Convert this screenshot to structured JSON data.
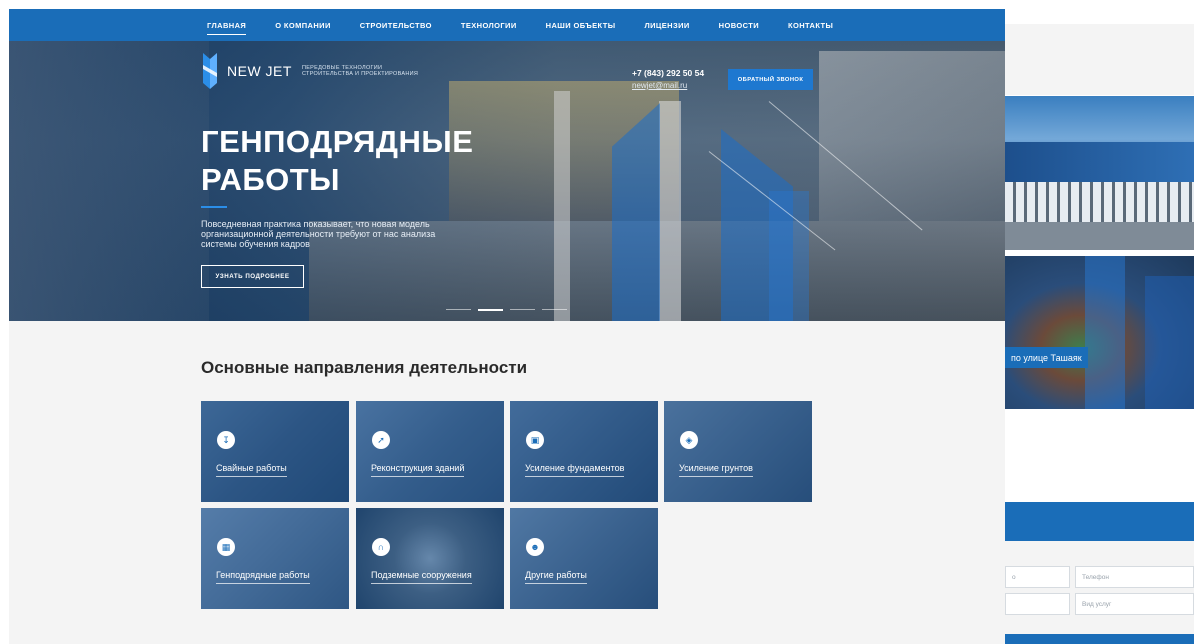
{
  "nav": {
    "items": [
      {
        "label": "ГЛАВНАЯ",
        "active": true
      },
      {
        "label": "О КОМПАНИИ",
        "active": false
      },
      {
        "label": "СТРОИТЕЛЬСТВО",
        "active": false
      },
      {
        "label": "ТЕХНОЛОГИИ",
        "active": false
      },
      {
        "label": "НАШИ ОБЪЕКТЫ",
        "active": false
      },
      {
        "label": "ЛИЦЕНЗИИ",
        "active": false
      },
      {
        "label": "НОВОСТИ",
        "active": false
      },
      {
        "label": "КОНТАКТЫ",
        "active": false
      }
    ]
  },
  "header": {
    "logo_name": "NEW JET",
    "tagline_line1": "ПЕРЕДОВЫЕ ТЕХНОЛОГИИ",
    "tagline_line2": "СТРОИТЕЛЬСТВА И ПРОЕКТИРОВАНИЯ",
    "phone": "+7 (843) 292 50 54",
    "email": "newjet@mail.ru",
    "callback_label": "ОБРАТНЫЙ ЗВОНОК"
  },
  "hero": {
    "title_line1": "ГЕНПОДРЯДНЫЕ",
    "title_line2": "РАБОТЫ",
    "description": "Повседневная практика показывает, что новая модель организационной деятельности требуют от нас анализа системы обучения кадров",
    "more_label": "УЗНАТЬ ПОДРОБНЕЕ",
    "slides_total": 4,
    "active_slide": 2
  },
  "directions": {
    "title": "Основные направления деятельности",
    "tiles": [
      {
        "label": "Свайные работы",
        "icon": "pile-icon"
      },
      {
        "label": "Реконструкция зданий",
        "icon": "arrow-icon"
      },
      {
        "label": "Усиление фундаментов",
        "icon": "foundation-icon"
      },
      {
        "label": "Усиление грунтов",
        "icon": "layers-icon"
      },
      {
        "label": "Генподрядные работы",
        "icon": "blueprint-icon"
      },
      {
        "label": "Подземные сооружения",
        "icon": "tunnel-icon"
      },
      {
        "label": "Другие работы",
        "icon": "worker-icon"
      }
    ]
  },
  "objects": {
    "caption": "по улице Ташаяк"
  },
  "form": {
    "field_left_top": "о",
    "phone_placeholder": "Телефон",
    "service_placeholder": "Вид услуг"
  },
  "colors": {
    "brand_blue": "#1a6db8",
    "accent_blue": "#1e78d0",
    "page_bg": "#f4f4f4"
  }
}
